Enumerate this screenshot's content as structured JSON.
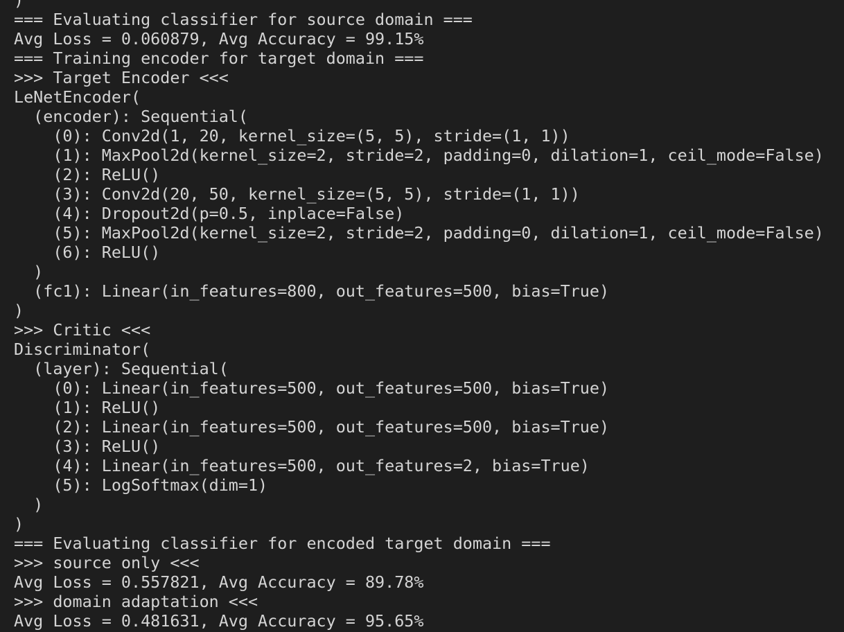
{
  "terminal": {
    "lines": [
      ")",
      "=== Evaluating classifier for source domain ===",
      "Avg Loss = 0.060879, Avg Accuracy = 99.15%",
      "=== Training encoder for target domain ===",
      ">>> Target Encoder <<<",
      "LeNetEncoder(",
      "  (encoder): Sequential(",
      "    (0): Conv2d(1, 20, kernel_size=(5, 5), stride=(1, 1))",
      "    (1): MaxPool2d(kernel_size=2, stride=2, padding=0, dilation=1, ceil_mode=False)",
      "    (2): ReLU()",
      "    (3): Conv2d(20, 50, kernel_size=(5, 5), stride=(1, 1))",
      "    (4): Dropout2d(p=0.5, inplace=False)",
      "    (5): MaxPool2d(kernel_size=2, stride=2, padding=0, dilation=1, ceil_mode=False)",
      "    (6): ReLU()",
      "  )",
      "  (fc1): Linear(in_features=800, out_features=500, bias=True)",
      ")",
      ">>> Critic <<<",
      "Discriminator(",
      "  (layer): Sequential(",
      "    (0): Linear(in_features=500, out_features=500, bias=True)",
      "    (1): ReLU()",
      "    (2): Linear(in_features=500, out_features=500, bias=True)",
      "    (3): ReLU()",
      "    (4): Linear(in_features=500, out_features=2, bias=True)",
      "    (5): LogSoftmax(dim=1)",
      "  )",
      ")",
      "=== Evaluating classifier for encoded target domain ===",
      ">>> source only <<<",
      "Avg Loss = 0.557821, Avg Accuracy = 89.78%",
      ">>> domain adaptation <<<",
      "Avg Loss = 0.481631, Avg Accuracy = 95.65%"
    ]
  },
  "colors": {
    "background": "#1e1e1e",
    "foreground": "#d4d4d4"
  }
}
